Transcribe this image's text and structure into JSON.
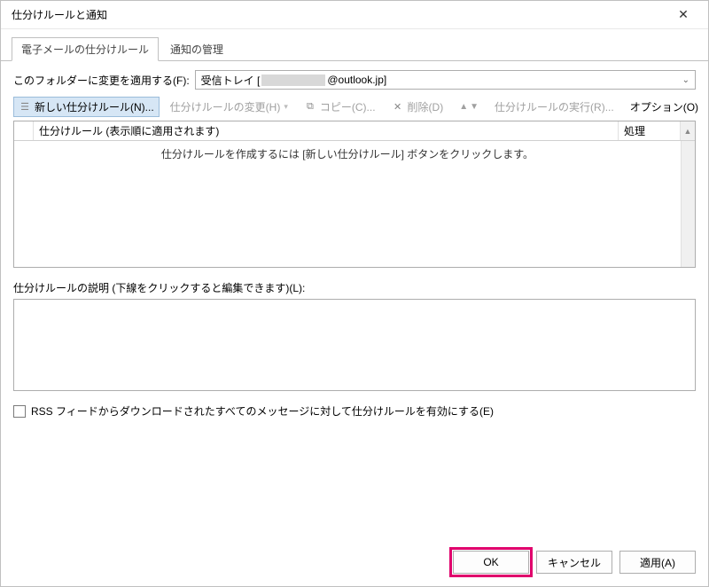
{
  "window": {
    "title": "仕分けルールと通知"
  },
  "tabs": {
    "email_rules": "電子メールの仕分けルール",
    "manage_alerts": "通知の管理"
  },
  "folder": {
    "label": "このフォルダーに変更を適用する(F):",
    "inbox_label": "受信トレイ [",
    "domain_part": "@outlook.jp]"
  },
  "toolbar": {
    "new_rule": "新しい仕分けルール(N)...",
    "change_rule": "仕分けルールの変更(H)",
    "copy": "コピー(C)...",
    "delete": "削除(D)",
    "run_rules": "仕分けルールの実行(R)...",
    "options": "オプション(O)"
  },
  "list": {
    "col_rule": "仕分けルール (表示順に適用されます)",
    "col_action": "処理",
    "empty_msg": "仕分けルールを作成するには [新しい仕分けルール] ボタンをクリックします。"
  },
  "description": {
    "label": "仕分けルールの説明 (下線をクリックすると編集できます)(L):"
  },
  "rss": {
    "label": "RSS フィードからダウンロードされたすべてのメッセージに対して仕分けルールを有効にする(E)"
  },
  "buttons": {
    "ok": "OK",
    "cancel": "キャンセル",
    "apply": "適用(A)"
  }
}
